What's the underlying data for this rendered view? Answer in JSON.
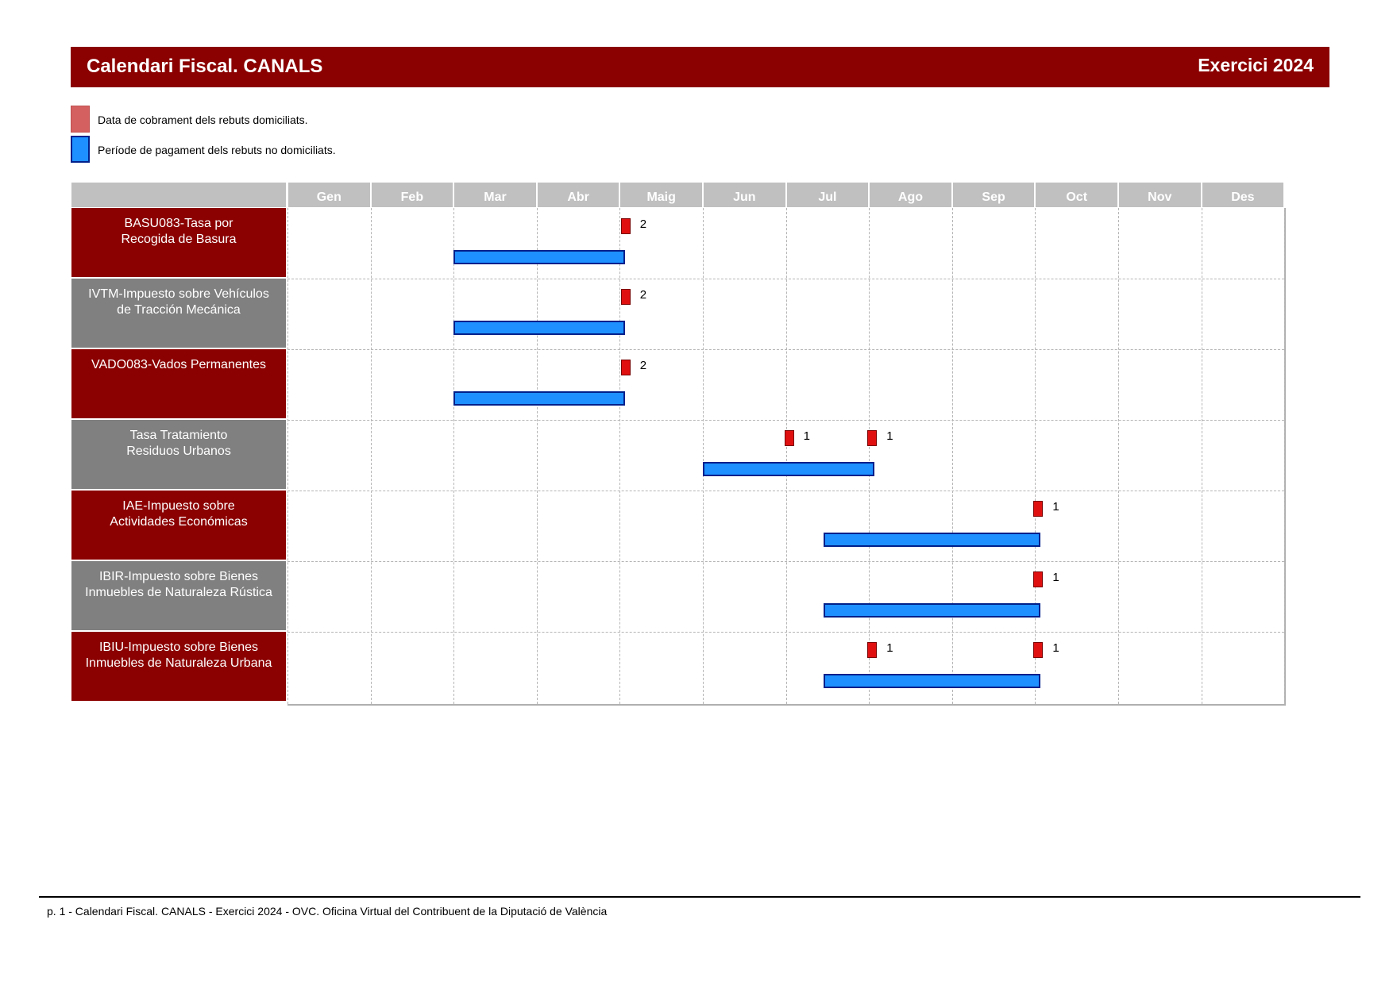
{
  "header": {
    "title": "Calendari Fiscal. CANALS",
    "year": "Exercici 2024"
  },
  "legend": {
    "domiciled": "Data de cobrament dels rebuts domiciliats.",
    "non_domiciled": "Període de pagament dels rebuts no domiciliats."
  },
  "colors": {
    "header": "#8b0000",
    "row_alt": "#808080",
    "bar": "#1e90ff",
    "bar_border": "#00208b",
    "mark": "#e01010"
  },
  "chart_data": {
    "type": "gantt",
    "months": [
      "Gen",
      "Feb",
      "Mar",
      "Abr",
      "Maig",
      "Jun",
      "Jul",
      "Ago",
      "Sep",
      "Oct",
      "Nov",
      "Des"
    ],
    "rows": [
      {
        "label": "BASU083-Tasa por\nRecogida de Basura",
        "style": "red",
        "period": {
          "start": "2024-03-01",
          "end": "2024-05-03"
        },
        "charges": [
          {
            "date": "2024-05-02",
            "label": "2"
          }
        ]
      },
      {
        "label": "IVTM-Impuesto sobre Vehículos\nde Tracción Mecánica",
        "style": "gray",
        "period": {
          "start": "2024-03-01",
          "end": "2024-05-03"
        },
        "charges": [
          {
            "date": "2024-05-02",
            "label": "2"
          }
        ]
      },
      {
        "label": "VADO083-Vados Permanentes",
        "style": "red",
        "period": {
          "start": "2024-03-01",
          "end": "2024-05-03"
        },
        "charges": [
          {
            "date": "2024-05-02",
            "label": "2"
          }
        ]
      },
      {
        "label": "Tasa Tratamiento\nResiduos Urbanos",
        "style": "gray",
        "period": {
          "start": "2024-06-01",
          "end": "2024-08-03"
        },
        "charges": [
          {
            "date": "2024-07-01",
            "label": "1"
          },
          {
            "date": "2024-08-01",
            "label": "1"
          }
        ]
      },
      {
        "label": "IAE-Impuesto sobre\nActividades Económicas",
        "style": "red",
        "period": {
          "start": "2024-07-15",
          "end": "2024-10-03"
        },
        "charges": [
          {
            "date": "2024-10-01",
            "label": "1"
          }
        ]
      },
      {
        "label": "IBIR-Impuesto sobre Bienes\nInmuebles de Naturaleza Rústica",
        "style": "gray",
        "period": {
          "start": "2024-07-15",
          "end": "2024-10-03"
        },
        "charges": [
          {
            "date": "2024-10-01",
            "label": "1"
          }
        ]
      },
      {
        "label": "IBIU-Impuesto sobre Bienes\nInmuebles de Naturaleza Urbana",
        "style": "red",
        "period": {
          "start": "2024-07-15",
          "end": "2024-10-03"
        },
        "charges": [
          {
            "date": "2024-08-01",
            "label": "1"
          },
          {
            "date": "2024-10-01",
            "label": "1"
          }
        ]
      }
    ]
  },
  "footer": {
    "text": "p. 1 - Calendari Fiscal. CANALS - Exercici 2024 - OVC. Oficina Virtual del Contribuent de la Diputació de València"
  }
}
